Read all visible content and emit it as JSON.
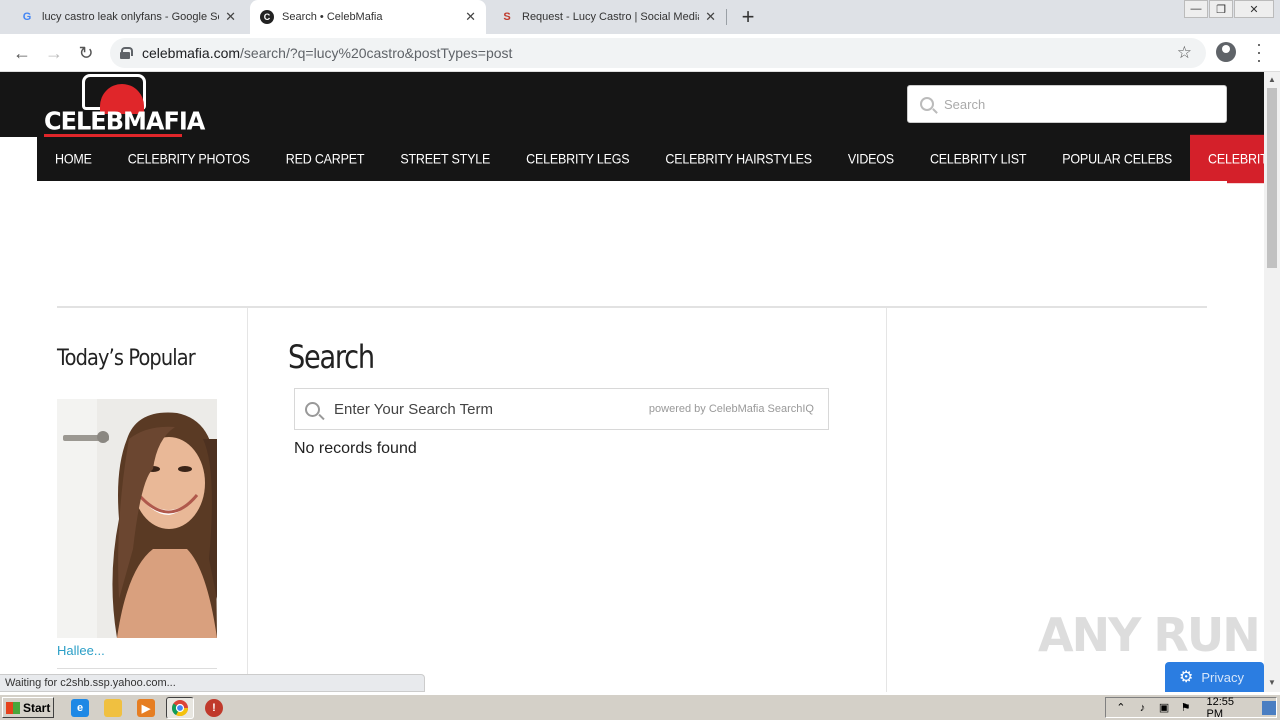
{
  "browser": {
    "tabs": [
      {
        "title": "lucy castro leak onlyfans - Google Se",
        "favicon": "G",
        "active": false
      },
      {
        "title": "Search • CelebMafia",
        "favicon": "C",
        "active": true
      },
      {
        "title": "Request - Lucy Castro | Social Media",
        "favicon": "S",
        "active": false
      }
    ],
    "url_host": "celebmafia.com",
    "url_path": "/search/?q=lucy%20castro&postTypes=post"
  },
  "site": {
    "logo_text": "CELEBMAFIA",
    "search_placeholder": "Search",
    "nav": [
      "HOME",
      "CELEBRITY PHOTOS",
      "RED CARPET",
      "STREET STYLE",
      "CELEBRITY LEGS",
      "CELEBRITY HAIRSTYLES",
      "VIDEOS",
      "CELEBRITY LIST",
      "POPULAR CELEBS",
      "CELEBRITY STYLE"
    ],
    "accent_color": "#d4202a"
  },
  "sidebar": {
    "title": "Today’s Popular",
    "item_name": "Hallee..."
  },
  "main": {
    "title": "Search",
    "search_placeholder": "Enter Your Search Term",
    "powered_by": "powered by CelebMafia SearchIQ",
    "result_text": "No records found"
  },
  "status": {
    "text": "Waiting for c2shb.ssp.yahoo.com..."
  },
  "overlay": {
    "watermark": "ANY RUN",
    "privacy_label": "Privacy"
  },
  "taskbar": {
    "start_label": "Start",
    "time": "12:55 PM"
  }
}
